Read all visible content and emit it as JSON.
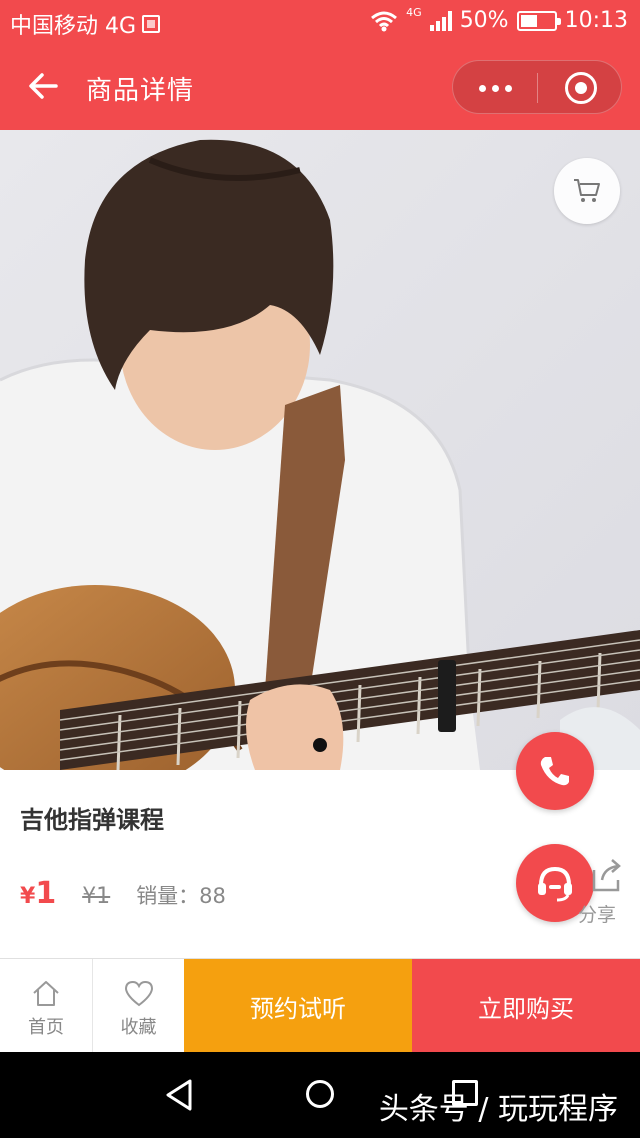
{
  "status_bar": {
    "carrier": "中国移动 4G",
    "net_type": "4G",
    "battery": "50%",
    "battery_level": 0.5,
    "time": "10:13"
  },
  "nav": {
    "title": "商品详情"
  },
  "product": {
    "title": "吉他指弹课程",
    "price_symbol": "¥",
    "price": "1",
    "original_price": "¥1",
    "sales": "销量：88",
    "share_label": "分享"
  },
  "carousel": {
    "total": 1,
    "current": 1
  },
  "bottom_bar": {
    "home_label": "首页",
    "favorite_label": "收藏",
    "trial_label": "预约试听",
    "buy_label": "立即购买"
  },
  "watermark": "头条号 / 玩玩程序",
  "colors": {
    "primary": "#f24a4d",
    "accent": "#f5a00f"
  },
  "icons": [
    "back-arrow-icon",
    "more-dots-icon",
    "close-mini-program-icon",
    "cart-icon",
    "phone-icon",
    "customer-service-icon",
    "share-icon",
    "home-icon",
    "heart-icon"
  ]
}
